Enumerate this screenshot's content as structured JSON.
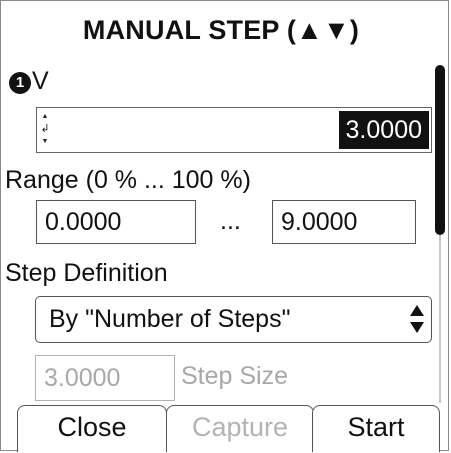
{
  "dialog": {
    "title": "MANUAL STEP (▲▼)"
  },
  "value": {
    "badge": "1",
    "unit": "V",
    "current": "3.0000",
    "up_glyph": "▲",
    "enter_glyph": "↲",
    "down_glyph": "▼"
  },
  "range": {
    "label": "Range (0 % ... 100 %)",
    "min": "0.0000",
    "separator": "...",
    "max": "9.0000"
  },
  "step_definition": {
    "label": "Step Definition",
    "selected": "By \"Number of Steps\""
  },
  "step_size": {
    "value": "3.0000",
    "label": "Step Size"
  },
  "tabs": [
    {
      "label": "Close",
      "enabled": true
    },
    {
      "label": "Capture",
      "enabled": false
    },
    {
      "label": "Start",
      "enabled": true
    }
  ],
  "colors": {
    "highlight": "#111111",
    "disabled_text": "#a8a8a8",
    "border": "#555555"
  }
}
